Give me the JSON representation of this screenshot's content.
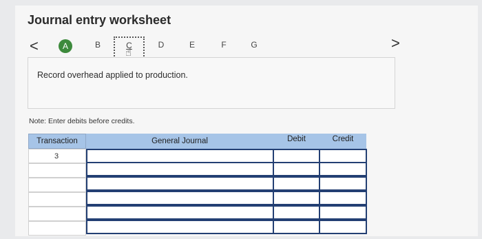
{
  "title": "Journal entry worksheet",
  "nav": {
    "prev_arrow": "<",
    "next_arrow": ">",
    "steps": [
      "A",
      "B",
      "C",
      "D",
      "E",
      "F",
      "G"
    ],
    "active_step": "C",
    "completed_step": "A"
  },
  "description": "Record overhead applied to production.",
  "note": "Note: Enter debits before credits.",
  "table": {
    "headers": {
      "transaction": "Transaction",
      "account": "General Journal",
      "debit": "Debit",
      "credit": "Credit"
    },
    "rows": [
      {
        "transaction": "3",
        "account": "",
        "debit": "",
        "credit": ""
      },
      {
        "transaction": "",
        "account": "",
        "debit": "",
        "credit": ""
      },
      {
        "transaction": "",
        "account": "",
        "debit": "",
        "credit": ""
      },
      {
        "transaction": "",
        "account": "",
        "debit": "",
        "credit": ""
      },
      {
        "transaction": "",
        "account": "",
        "debit": "",
        "credit": ""
      },
      {
        "transaction": "",
        "account": "",
        "debit": "",
        "credit": ""
      }
    ]
  },
  "colors": {
    "header_bg": "#a6c4e7",
    "step_complete": "#3d8a3c",
    "input_border": "#233f73"
  },
  "icons": {
    "pointer": "hand-pointer-icon"
  }
}
